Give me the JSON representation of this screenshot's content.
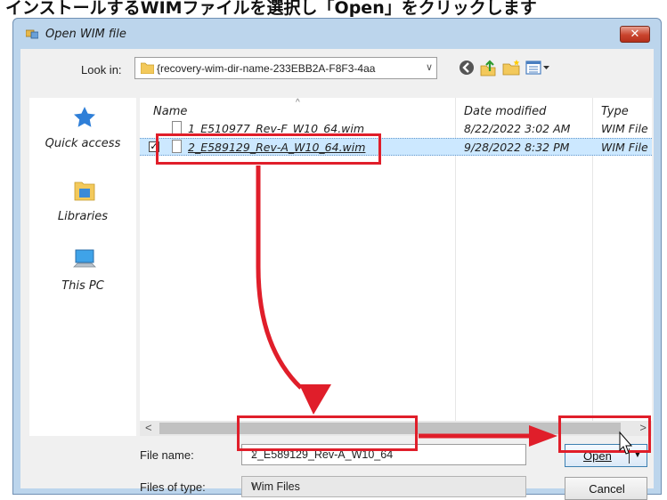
{
  "banner": {
    "text": "インストールするWIMファイルを選択し「Open」をクリックします"
  },
  "window": {
    "title": "Open WIM file",
    "close_label": "✕"
  },
  "lookin": {
    "label": "Look in:",
    "value": "{recovery-wim-dir-name-233EBB2A-F8F3-4aa",
    "toolbar_icons": [
      "back-icon",
      "up-folder-icon",
      "new-folder-icon",
      "view-menu-icon"
    ]
  },
  "places": [
    {
      "label": "Quick access",
      "icon": "star-icon"
    },
    {
      "label": "Libraries",
      "icon": "libraries-folder-icon"
    },
    {
      "label": "This PC",
      "icon": "computer-icon"
    }
  ],
  "filelist": {
    "columns": {
      "name": "Name",
      "date": "Date modified",
      "type": "Type"
    },
    "rows": [
      {
        "name": "1_E510977_Rev-F_W10_64.wim",
        "date": "8/22/2022 3:02 AM",
        "type": "WIM File",
        "selected": false
      },
      {
        "name": "2_E589129_Rev-A_W10_64.wim",
        "date": "9/28/2022 8:32 PM",
        "type": "WIM File",
        "selected": true
      }
    ]
  },
  "scrollbar": {
    "left_arrow": "<",
    "right_arrow": ">"
  },
  "filename": {
    "label": "File name:",
    "value": "2_E589129_Rev-A_W10_64"
  },
  "filetype": {
    "label": "Files of type:",
    "value": "Wim Files"
  },
  "buttons": {
    "open": "Open",
    "cancel": "Cancel"
  },
  "colors": {
    "highlight": "#e01e2a",
    "selection": "#cce8ff",
    "dialog_frame": "#bcd5ec"
  }
}
